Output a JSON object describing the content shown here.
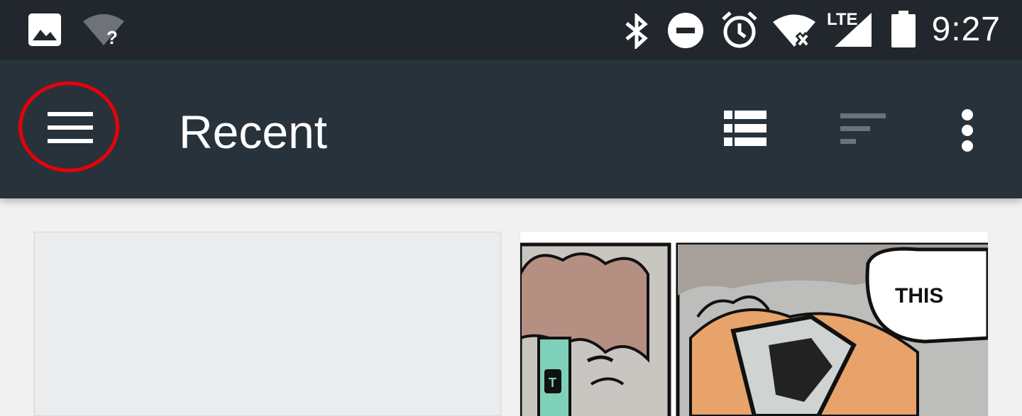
{
  "status_bar": {
    "time": "9:27",
    "network_label": "LTE",
    "icons": [
      "image-icon",
      "wifi-unknown-icon",
      "bluetooth-icon",
      "do-not-disturb-icon",
      "alarm-icon",
      "wifi-off-icon",
      "cell-signal-icon",
      "battery-icon"
    ]
  },
  "app_bar": {
    "title": "Recent",
    "menu_icon": "hamburger-menu-icon",
    "actions": [
      "list-view-icon",
      "sort-icon",
      "more-options-icon"
    ]
  },
  "content": {
    "cards": [
      {
        "type": "blank-preview"
      },
      {
        "type": "comic-preview",
        "speech_text": "THIS",
        "badge_text": "T"
      }
    ]
  },
  "colors": {
    "status_bar": "#21272c",
    "app_bar": "#28323a",
    "annotation": "#e8000b",
    "background": "#f1f1f1"
  }
}
